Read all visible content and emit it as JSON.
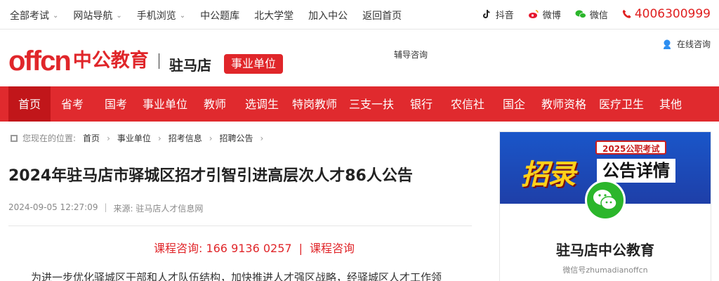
{
  "topbar": {
    "nav": [
      "全部考试",
      "网站导航",
      "手机浏览",
      "中公题库",
      "北大学堂",
      "加入中公",
      "返回首页"
    ],
    "social": [
      "抖音",
      "微博",
      "微信"
    ],
    "phone": "4006300999"
  },
  "header": {
    "logo_en": "offcn",
    "logo_cn": "中公教育",
    "city": "驻马店",
    "category_badge": "事业单位",
    "fudao": "辅导咨询",
    "online": "在线咨询"
  },
  "mainnav": [
    "首页",
    "省考",
    "国考",
    "事业单位",
    "教师",
    "选调生",
    "特岗教师",
    "三支一扶",
    "银行",
    "农信社",
    "国企",
    "教师资格",
    "医疗卫生",
    "其他"
  ],
  "breadcrumb": {
    "lead": "您现在的位置:",
    "items": [
      "首页",
      "事业单位",
      "招考信息",
      "招聘公告"
    ]
  },
  "article": {
    "title": "2024年驻马店市驿城区招才引智引进高层次人才86人公告",
    "date": "2024-09-05 12:27:09",
    "source": "来源: 驻马店人才信息网",
    "consult_label": "课程咨询: 166 9136 0257",
    "consult_link": "课程咨询",
    "body": "为进一步优化驿城区干部和人才队伍结构，加快推进人才强区战略，经驿城区人才工作领"
  },
  "sidebar": {
    "banner_year": "2025公职考试",
    "banner_big": "招录",
    "banner_tag": "公告详情",
    "name": "驻马店中公教育",
    "wechat": "微信号zhumadianoffcn"
  }
}
